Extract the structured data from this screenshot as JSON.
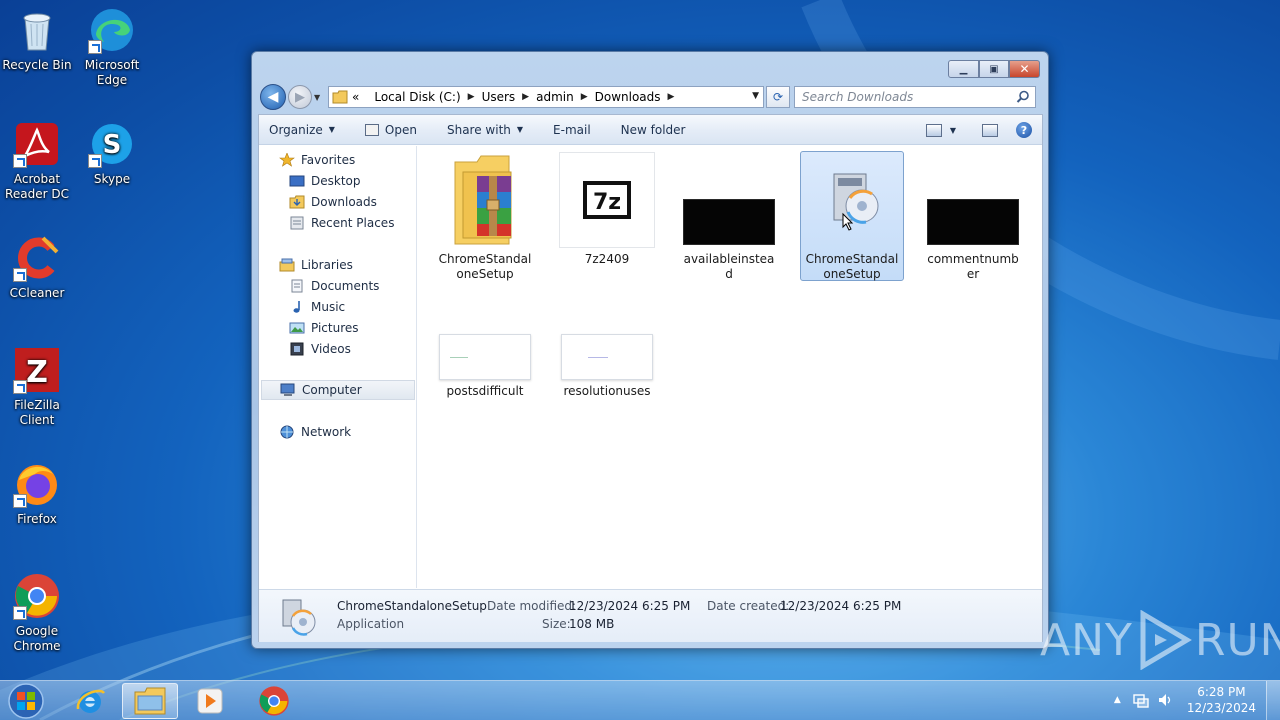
{
  "desktop": {
    "icons": [
      {
        "label": "Recycle Bin",
        "icon": "recycle-bin-icon"
      },
      {
        "label": "Microsoft Edge",
        "icon": "edge-icon"
      },
      {
        "label": "Acrobat Reader DC",
        "icon": "acrobat-icon"
      },
      {
        "label": "Skype",
        "icon": "skype-icon"
      },
      {
        "label": "CCleaner",
        "icon": "ccleaner-icon"
      },
      {
        "label": "FileZilla Client",
        "icon": "filezilla-icon"
      },
      {
        "label": "Firefox",
        "icon": "firefox-icon"
      },
      {
        "label": "Google Chrome",
        "icon": "chrome-icon"
      }
    ]
  },
  "window": {
    "breadcrumb": {
      "prefix": "«",
      "items": [
        "Local Disk (C:)",
        "Users",
        "admin",
        "Downloads"
      ]
    },
    "search_placeholder": "Search Downloads",
    "toolbar": {
      "organize": "Organize",
      "open": "Open",
      "share_with": "Share with",
      "email": "E-mail",
      "new_folder": "New folder"
    },
    "nav": {
      "favorites": "Favorites",
      "desktop": "Desktop",
      "downloads": "Downloads",
      "recent_places": "Recent Places",
      "libraries": "Libraries",
      "documents": "Documents",
      "music": "Music",
      "pictures": "Pictures",
      "videos": "Videos",
      "computer": "Computer",
      "network": "Network"
    },
    "files": [
      {
        "name": "ChromeStandaloneSetup",
        "type": "winrar-archive"
      },
      {
        "name": "7z2409",
        "type": "7z-installer"
      },
      {
        "name": "availableinstead",
        "type": "dark-image"
      },
      {
        "name": "ChromeStandaloneSetup",
        "type": "setup-exe",
        "selected": true
      },
      {
        "name": "commentnumber",
        "type": "dark-image"
      },
      {
        "name": "postsdifficult",
        "type": "light-image"
      },
      {
        "name": "resolutionuses",
        "type": "light-image"
      }
    ],
    "details": {
      "name": "ChromeStandaloneSetup",
      "type": "Application",
      "date_modified_label": "Date modified:",
      "date_modified": "12/23/2024 6:25 PM",
      "date_created_label": "Date created:",
      "date_created": "12/23/2024 6:25 PM",
      "size_label": "Size:",
      "size": "108 MB"
    }
  },
  "taskbar": {
    "apps": [
      "internet-explorer-icon",
      "explorer-icon",
      "media-player-icon",
      "chrome-icon"
    ],
    "time": "6:28 PM",
    "date": "12/23/2024"
  },
  "watermark": {
    "left": "ANY",
    "right": "RUN"
  }
}
